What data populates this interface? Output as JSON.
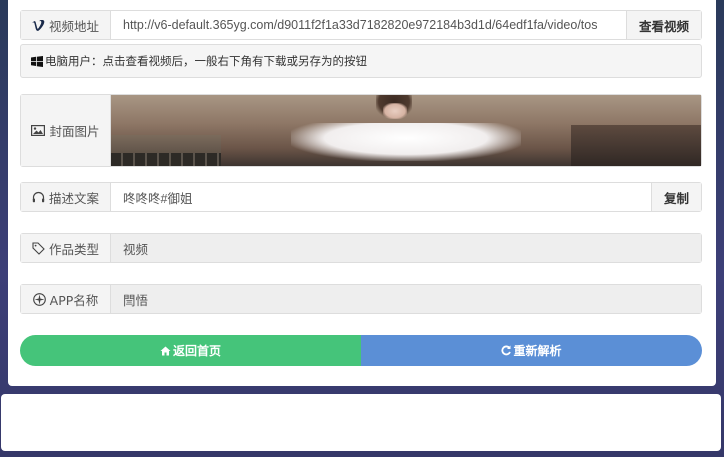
{
  "url_row": {
    "label": "视频地址",
    "icon": "vimeo-v-icon",
    "value": "http://v6-default.365yg.com/d9011f2f1a33d7182820e972184b3d1d/64edf1fa/video/tos",
    "button": "查看视频"
  },
  "notice": {
    "icon": "windows-icon",
    "text": "电脑用户：点击查看视频后，一般右下角有下载或另存为的按钮"
  },
  "cover_row": {
    "label": "封面图片",
    "icon": "image-icon"
  },
  "desc_row": {
    "label": "描述文案",
    "icon": "headphones-icon",
    "value": "咚咚咚#御姐",
    "button": "复制"
  },
  "type_row": {
    "label": "作品类型",
    "icon": "tag-icon",
    "value": "视频"
  },
  "app_row": {
    "label": "APP名称",
    "icon": "gear-flower-icon",
    "value": "閆悟"
  },
  "actions": {
    "home": {
      "label": "返回首页",
      "icon": "home-icon",
      "color": "#45c47a"
    },
    "reparse": {
      "label": "重新解析",
      "icon": "refresh-icon",
      "color": "#5b8fd6"
    }
  }
}
